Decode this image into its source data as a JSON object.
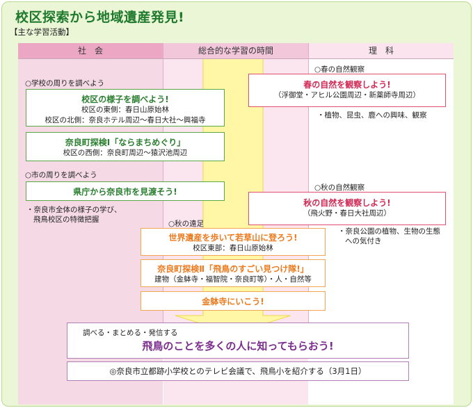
{
  "title": "校区探索から地域遺産発見!",
  "subtitle": "【主な学習活動】",
  "columns": {
    "social": "社　会",
    "integrated": "総合的な学習の時間",
    "science": "理　科"
  },
  "social": {
    "label1": "○学校の周りを調べよう",
    "box1": {
      "title": "校区の様子を調べよう!",
      "line1": "校区の東側：春日山原始林",
      "line2": "校区の北側：奈良ホテル周辺〜春日大社〜興福寺"
    },
    "box2": {
      "title": "奈良町探検Ⅰ「ならまちめぐり」",
      "line1": "校区の西側：奈良町周辺〜猿沢池周辺"
    },
    "label2": "○市の周りを調べよう",
    "box3": {
      "title": "県庁から奈良市を見渡そう!"
    },
    "note_line1": "・奈良市全体の様子の学び、",
    "note_line2": "飛鳥校区の特徴把握"
  },
  "integrated": {
    "label1": "○秋の遠足",
    "box1": {
      "title": "世界遺産を歩いて若草山に登ろう!",
      "line1": "校区東部：春日山原始林"
    },
    "box2": {
      "title": "奈良町探検Ⅱ「飛鳥のすごい見つけ隊!」",
      "line1": "建物（金躰寺・福智院・奈良町等）・人・自然等"
    },
    "box3": {
      "title": "金躰寺にいこう!"
    }
  },
  "science": {
    "label1": "○春の自然観察",
    "box1": {
      "title": "春の自然を観察しよう!",
      "line1": "（浮御堂・アヒル公園周辺・新薬師寺周辺）"
    },
    "note1": "・植物、昆虫、鹿への興味、観察",
    "label2": "○秋の自然観察",
    "box2": {
      "title": "秋の自然を観察しよう!",
      "line1": "（飛火野・春日大社周辺）"
    },
    "note2_line1": "・奈良公園の植物、生物の生態",
    "note2_line2": "への気付き"
  },
  "summary": {
    "label": "調べる・まとめる・発信する",
    "goal": "飛鳥のことを多くの人に知ってもらおう!"
  },
  "bottom_note": "◎奈良市立都跡小学校とのテレビ会議で、飛鳥小を紹介する（3月1日）"
}
